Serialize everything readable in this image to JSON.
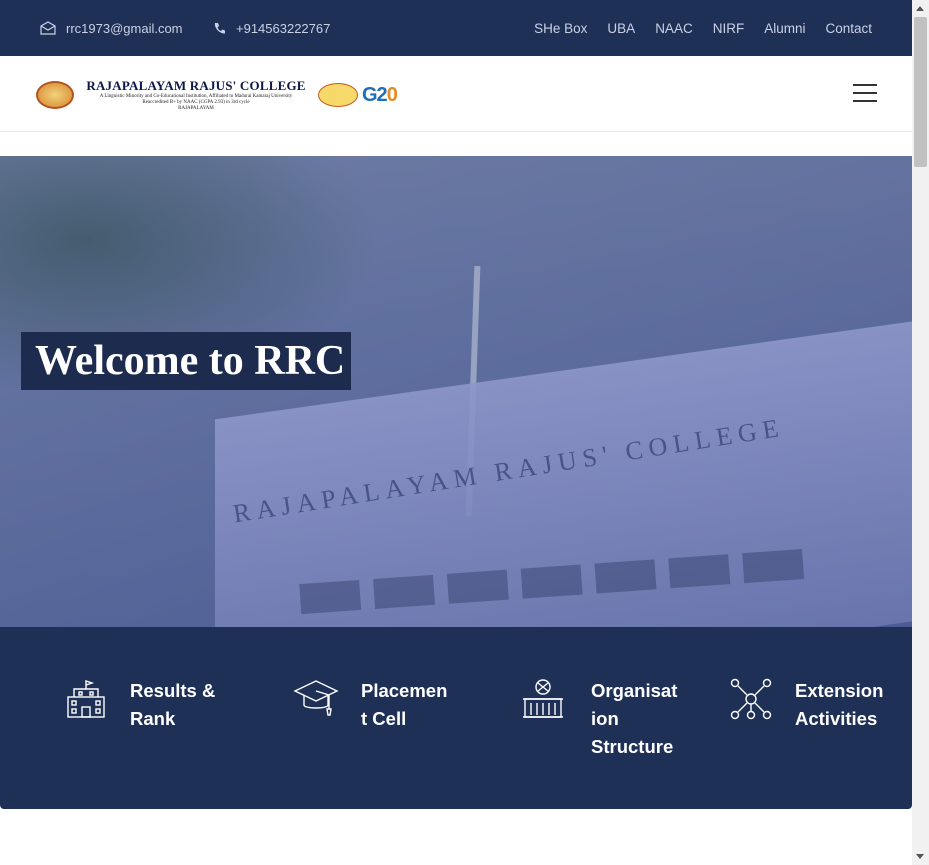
{
  "topbar": {
    "email": "rrc1973@gmail.com",
    "phone": "+914563222767",
    "links": [
      "SHe Box",
      "UBA",
      "NAAC",
      "NIRF",
      "Alumni",
      "Contact"
    ]
  },
  "header": {
    "logo": {
      "college_name": "RAJAPALAYAM RAJUS' COLLEGE",
      "sub_line1": "A Linguistic Minority and Co-Educational Institution, Affiliated to Madurai Kamaraj University",
      "sub_line2": "Reaccredited B+ by NAAC (CGPA 2.93) in 3rd cycle",
      "sub_line3": "RAJAPALAYAM",
      "g20_main": "G2",
      "g20_zero": "0"
    }
  },
  "hero": {
    "title": "Welcome to RRC",
    "building_text": "RAJAPALAYAM RAJUS' COLLEGE"
  },
  "features": [
    {
      "label_line1": "Results &",
      "label_line2": "Rank",
      "label_line3": "",
      "icon": "school-building-icon"
    },
    {
      "label_line1": "Placemen",
      "label_line2": "t Cell",
      "label_line3": "",
      "icon": "graduation-cap-icon"
    },
    {
      "label_line1": "Organisat",
      "label_line2": "ion",
      "label_line3": "Structure",
      "icon": "organisation-icon"
    },
    {
      "label_line1": "Extension",
      "label_line2": "Activities",
      "label_line3": "",
      "icon": "network-icon"
    }
  ],
  "colors": {
    "navy": "#1f3057",
    "title_box": "#1d2b4f",
    "hero_overlay": "#54649a"
  }
}
